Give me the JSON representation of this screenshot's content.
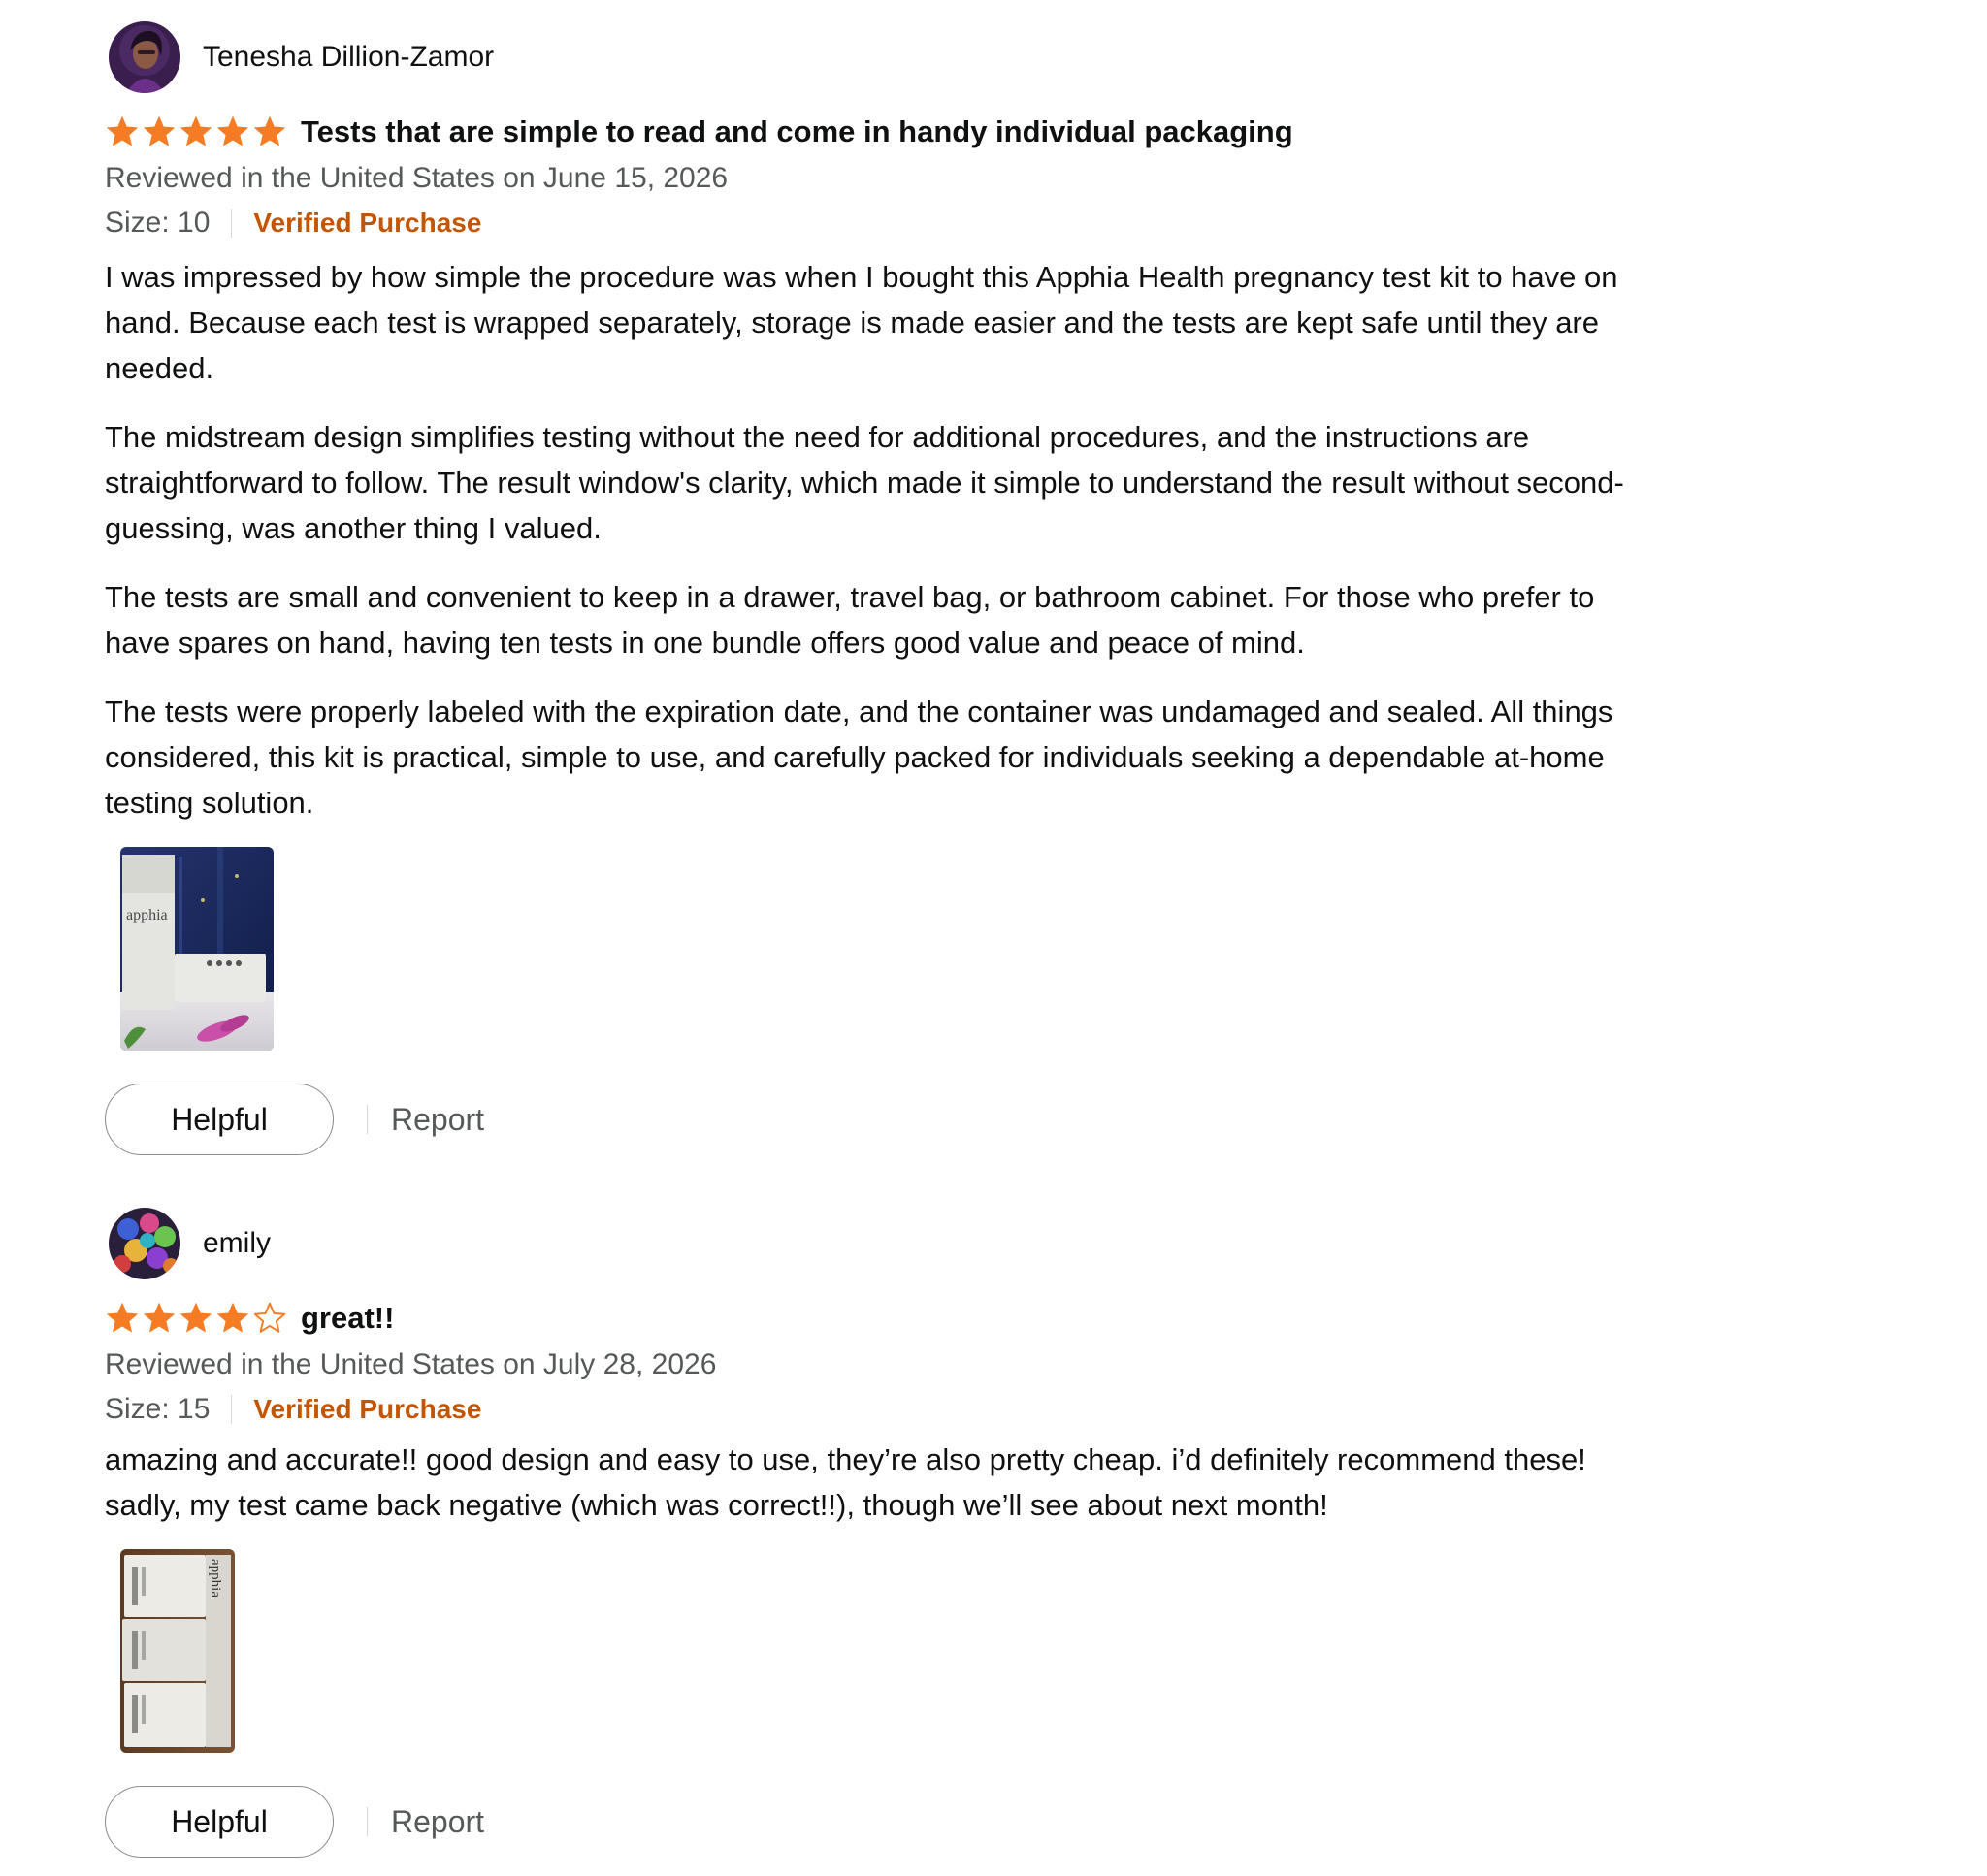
{
  "colors": {
    "star_filled": "#f57c24",
    "verified": "#c45500",
    "muted_text": "#565959",
    "main_text": "#0f1111"
  },
  "reviews": [
    {
      "author": "Tenesha Dillion-Zamor",
      "rating": 5,
      "rating_max": 5,
      "title": "Tests that are simple to read and come in handy individual packaging",
      "date": "Reviewed in the United States on June 15, 2026",
      "size": "Size: 10",
      "verified": "Verified Purchase",
      "paragraphs": [
        "I was impressed by how simple the procedure was when I bought this Apphia Health pregnancy test kit to have on hand. Because each test is wrapped separately, storage is made easier and the tests are kept safe until they are needed.",
        "The midstream design simplifies testing without the need for additional procedures, and the instructions are straightforward to follow. The result window's clarity, which made it simple to understand the result without second-guessing, was another thing I valued.",
        "The tests are small and convenient to keep in a drawer, travel bag, or bathroom cabinet. For those who prefer to have spares on hand, having ten tests in one bundle offers good value and peace of mind.",
        "The tests were properly labeled with the expiration date, and the container was undamaged and sealed. All things considered, this kit is practical, simple to use, and carefully packed for individuals seeking a dependable at-home testing solution."
      ],
      "image_brand_text": "apphia",
      "helpful_label": "Helpful",
      "report_label": "Report"
    },
    {
      "author": "emily",
      "rating": 4,
      "rating_max": 5,
      "title": "great!!",
      "date": "Reviewed in the United States on July 28, 2026",
      "size": "Size: 15",
      "verified": "Verified Purchase",
      "paragraphs": [
        "amazing and accurate!! good design and easy to use, they’re also pretty cheap. i’d definitely recommend these! sadly, my test came back negative (which was correct!!), though we’ll see about next month!"
      ],
      "image_brand_text": "apphia",
      "helpful_label": "Helpful",
      "report_label": "Report"
    }
  ]
}
